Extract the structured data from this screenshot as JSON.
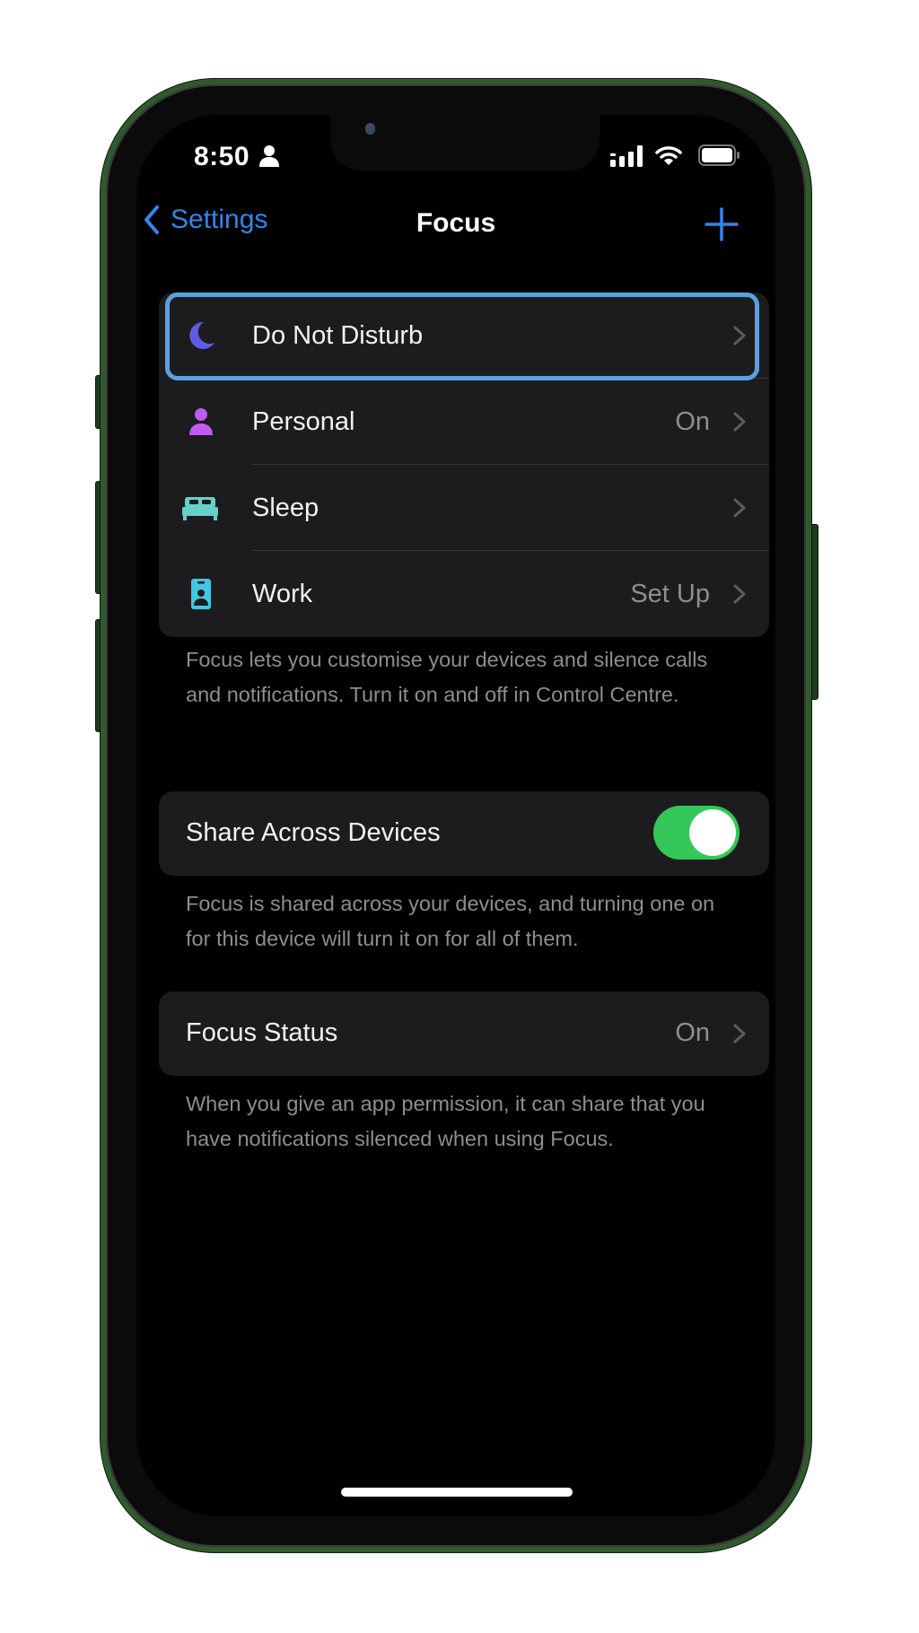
{
  "status_bar": {
    "time": "8:50",
    "icons": [
      "person-icon",
      "signal-icon",
      "wifi-icon",
      "battery-icon"
    ]
  },
  "nav": {
    "back_label": "Settings",
    "title": "Focus",
    "add_icon": "plus-icon"
  },
  "focus_modes": [
    {
      "label": "Do Not Disturb",
      "value": "",
      "icon": "moon-icon",
      "icon_color": "#5e5ce6",
      "highlighted": true
    },
    {
      "label": "Personal",
      "value": "On",
      "icon": "person-icon",
      "icon_color": "#bf5af2"
    },
    {
      "label": "Sleep",
      "value": "",
      "icon": "bed-icon",
      "icon_color": "#64d2c8"
    },
    {
      "label": "Work",
      "value": "Set Up",
      "icon": "id-badge-icon",
      "icon_color": "#40c8e0"
    }
  ],
  "focus_modes_footer": "Focus lets you customise your devices and silence calls and notifications. Turn it on and off in Control Centre.",
  "share_across_devices": {
    "label": "Share Across Devices",
    "enabled": true,
    "footer": "Focus is shared across your devices, and turning one on for this device will turn it on for all of them."
  },
  "focus_status": {
    "label": "Focus Status",
    "value": "On",
    "footer": "When you give an app permission, it can share that you have notifications silenced when using Focus."
  },
  "colors": {
    "accent": "#2f86f0",
    "toggle_on": "#34c759",
    "highlight_border": "#5aa0e0",
    "frame": "#2f5a2c"
  }
}
